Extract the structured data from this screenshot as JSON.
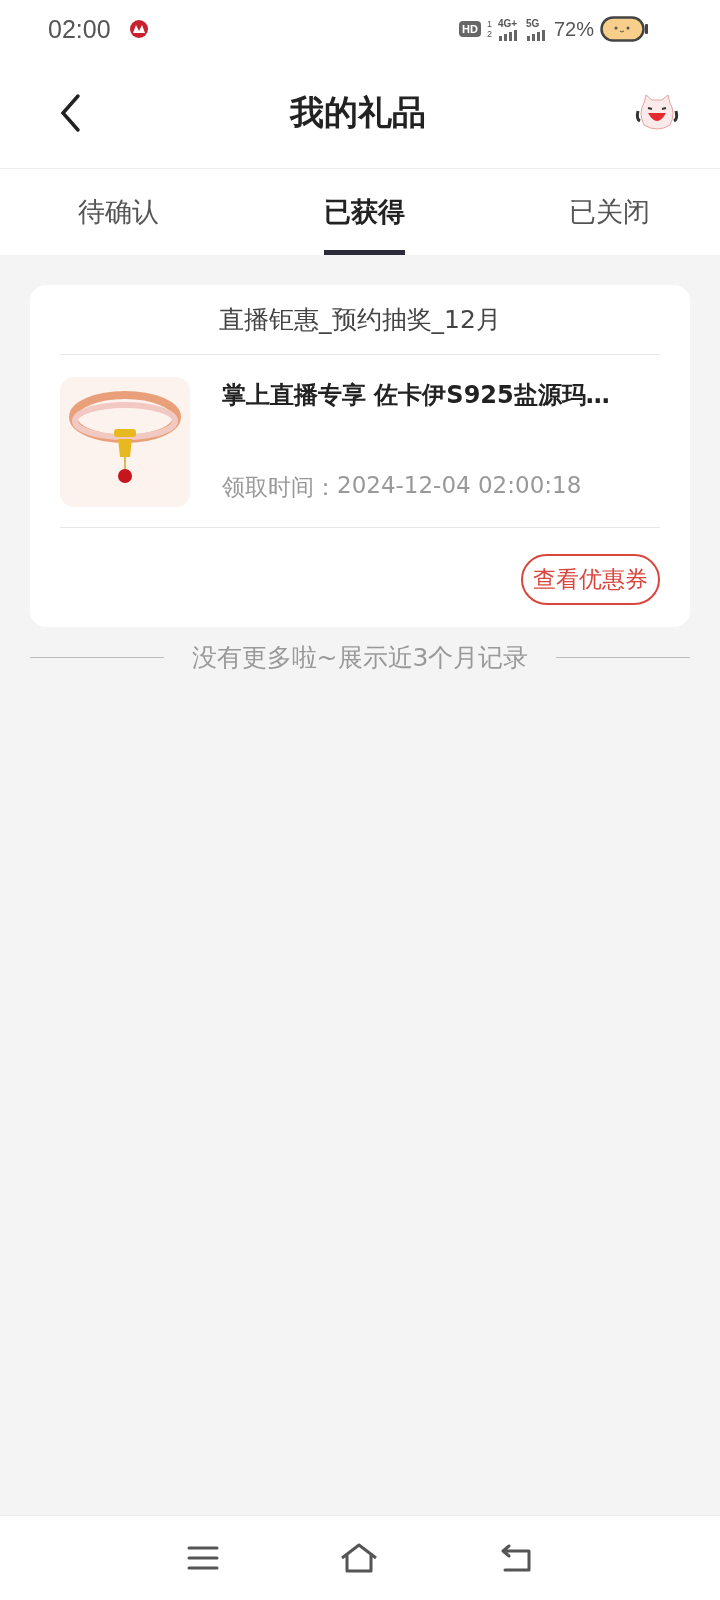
{
  "status_bar": {
    "time": "02:00",
    "hd": "HD",
    "sim_slots": [
      "1",
      "2"
    ],
    "networks": [
      "4G+",
      "5G"
    ],
    "battery": "72%"
  },
  "header": {
    "title": "我的礼品"
  },
  "tabs": [
    {
      "label": "待确认",
      "selected": false
    },
    {
      "label": "已获得",
      "selected": true
    },
    {
      "label": "已关闭",
      "selected": false
    }
  ],
  "gifts": [
    {
      "campaign": "直播钜惠_预约抽奖_12月",
      "name": "掌上直播专享 佐卡伊S925盐源玛…",
      "time_label": "领取时间：",
      "time": "2024-12-04 02:00:18",
      "action": "查看优惠券"
    }
  ],
  "footer_note": "没有更多啦~展示近3个月记录"
}
